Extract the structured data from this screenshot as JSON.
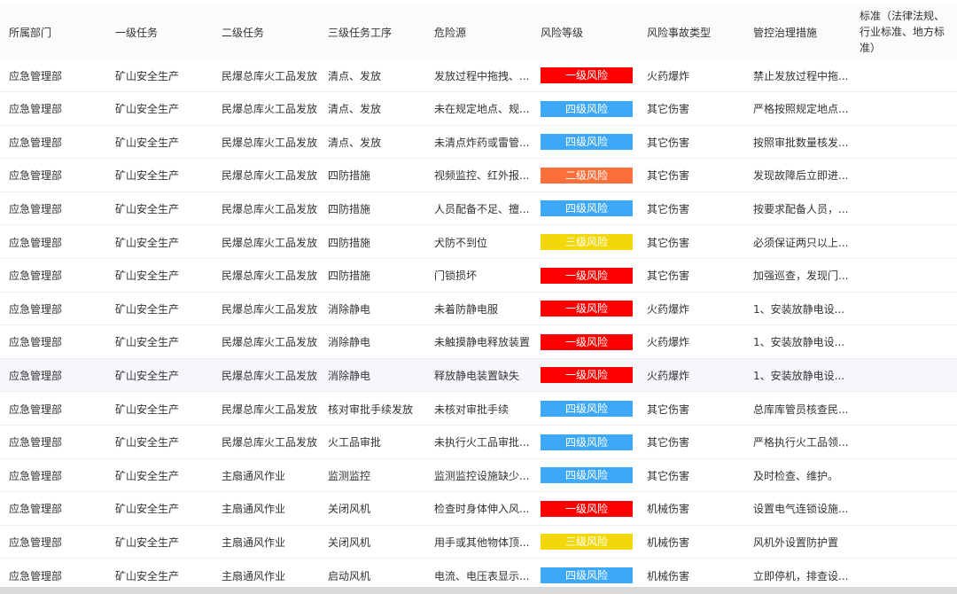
{
  "colors": {
    "level1": "#ff0000",
    "level2": "#ff6f3a",
    "level3": "#f2d80a",
    "level4": "#3da8f5"
  },
  "columns": {
    "dept": "所属部门",
    "task1": "一级任务",
    "task2": "二级任务",
    "task3": "三级任务工序",
    "hazard": "危险源",
    "risk": "风险等级",
    "accident": "风险事故类型",
    "measure": "管控治理措施",
    "standard": "标准（法律法规、行业标准、地方标准）"
  },
  "rows": [
    {
      "dept": "应急管理部",
      "task1": "矿山安全生产",
      "task2": "民爆总库火工品发放",
      "task3": "清点、发放",
      "hazard": "发放过程中拖拽、...",
      "risk": "一级风险",
      "level": "level1",
      "accident": "火药爆炸",
      "measure": "禁止发放过程中拖...",
      "standard": ""
    },
    {
      "dept": "应急管理部",
      "task1": "矿山安全生产",
      "task2": "民爆总库火工品发放",
      "task3": "清点、发放",
      "hazard": "未在规定地点、规...",
      "risk": "四级风险",
      "level": "level4",
      "accident": "其它伤害",
      "measure": "严格按照规定地点...",
      "standard": ""
    },
    {
      "dept": "应急管理部",
      "task1": "矿山安全生产",
      "task2": "民爆总库火工品发放",
      "task3": "清点、发放",
      "hazard": "未清点炸药或雷管...",
      "risk": "四级风险",
      "level": "level4",
      "accident": "其它伤害",
      "measure": "按照审批数量核发...",
      "standard": ""
    },
    {
      "dept": "应急管理部",
      "task1": "矿山安全生产",
      "task2": "民爆总库火工品发放",
      "task3": "四防措施",
      "hazard": "视频监控、红外报...",
      "risk": "二级风险",
      "level": "level2",
      "accident": "其它伤害",
      "measure": "发现故障后立即进...",
      "standard": ""
    },
    {
      "dept": "应急管理部",
      "task1": "矿山安全生产",
      "task2": "民爆总库火工品发放",
      "task3": "四防措施",
      "hazard": "人员配备不足、擅...",
      "risk": "四级风险",
      "level": "level4",
      "accident": "其它伤害",
      "measure": "按要求配备人员，...",
      "standard": ""
    },
    {
      "dept": "应急管理部",
      "task1": "矿山安全生产",
      "task2": "民爆总库火工品发放",
      "task3": "四防措施",
      "hazard": "犬防不到位",
      "risk": "三级风险",
      "level": "level3",
      "accident": "其它伤害",
      "measure": "必须保证两只以上...",
      "standard": ""
    },
    {
      "dept": "应急管理部",
      "task1": "矿山安全生产",
      "task2": "民爆总库火工品发放",
      "task3": "四防措施",
      "hazard": "门锁损坏",
      "risk": "一级风险",
      "level": "level1",
      "accident": "其它伤害",
      "measure": "加强巡查，发现门...",
      "standard": ""
    },
    {
      "dept": "应急管理部",
      "task1": "矿山安全生产",
      "task2": "民爆总库火工品发放",
      "task3": "消除静电",
      "hazard": "未着防静电服",
      "risk": "一级风险",
      "level": "level1",
      "accident": "火药爆炸",
      "measure": "1、安装放静电设...",
      "standard": ""
    },
    {
      "dept": "应急管理部",
      "task1": "矿山安全生产",
      "task2": "民爆总库火工品发放",
      "task3": "消除静电",
      "hazard": "未触摸静电释放装置",
      "risk": "一级风险",
      "level": "level1",
      "accident": "火药爆炸",
      "measure": "1、安装放静电设...",
      "standard": ""
    },
    {
      "dept": "应急管理部",
      "task1": "矿山安全生产",
      "task2": "民爆总库火工品发放",
      "task3": "消除静电",
      "hazard": "释放静电装置缺失",
      "risk": "一级风险",
      "level": "level1",
      "accident": "火药爆炸",
      "measure": "1、安装放静电设...",
      "standard": ""
    },
    {
      "dept": "应急管理部",
      "task1": "矿山安全生产",
      "task2": "民爆总库火工品发放",
      "task3": "核对审批手续发放",
      "hazard": "未核对审批手续",
      "risk": "四级风险",
      "level": "level4",
      "accident": "其它伤害",
      "measure": "总库库管员核查民...",
      "standard": ""
    },
    {
      "dept": "应急管理部",
      "task1": "矿山安全生产",
      "task2": "民爆总库火工品发放",
      "task3": "火工品审批",
      "hazard": "未执行火工品审批...",
      "risk": "四级风险",
      "level": "level4",
      "accident": "其它伤害",
      "measure": "严格执行火工品领...",
      "standard": ""
    },
    {
      "dept": "应急管理部",
      "task1": "矿山安全生产",
      "task2": "主扇通风作业",
      "task3": "监测监控",
      "hazard": "监测监控设施缺少...",
      "risk": "四级风险",
      "level": "level4",
      "accident": "其它伤害",
      "measure": "及时检查、维护。",
      "standard": ""
    },
    {
      "dept": "应急管理部",
      "task1": "矿山安全生产",
      "task2": "主扇通风作业",
      "task3": "关闭风机",
      "hazard": "检查时身体伸入风...",
      "risk": "一级风险",
      "level": "level1",
      "accident": "机械伤害",
      "measure": "设置电气连锁设施...",
      "standard": ""
    },
    {
      "dept": "应急管理部",
      "task1": "矿山安全生产",
      "task2": "主扇通风作业",
      "task3": "关闭风机",
      "hazard": "用手或其他物体顶...",
      "risk": "三级风险",
      "level": "level3",
      "accident": "机械伤害",
      "measure": "风机外设置防护置",
      "standard": ""
    },
    {
      "dept": "应急管理部",
      "task1": "矿山安全生产",
      "task2": "主扇通风作业",
      "task3": "启动风机",
      "hazard": "电流、电压表显示...",
      "risk": "四级风险",
      "level": "level4",
      "accident": "机械伤害",
      "measure": "立即停机，排查设...",
      "standard": ""
    }
  ]
}
